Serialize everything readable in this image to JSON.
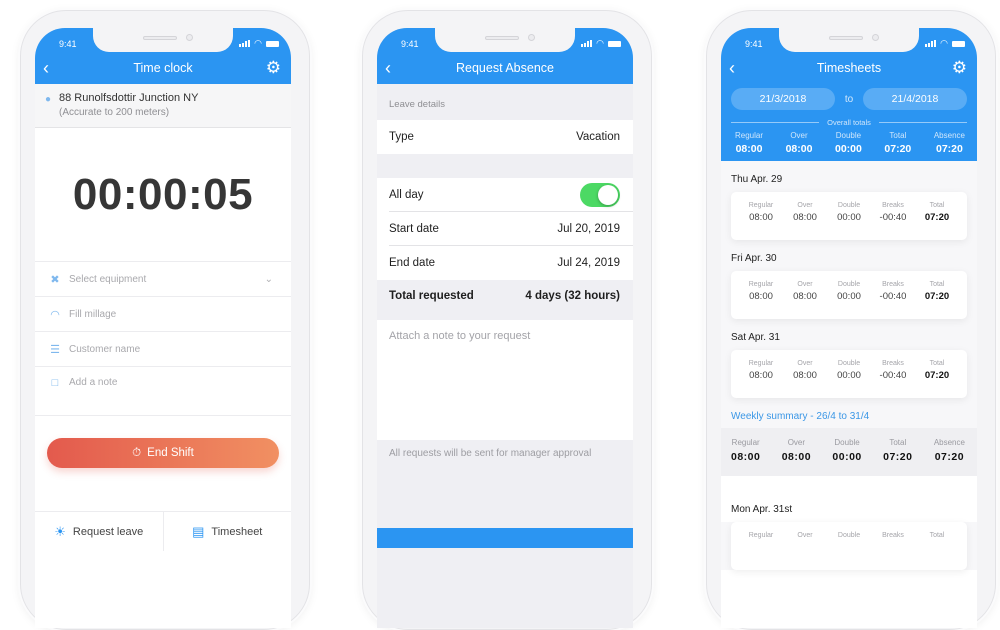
{
  "status_bar": {
    "time": "9:41"
  },
  "time_clock": {
    "title": "Time clock",
    "location": {
      "address": "88 Runolfsdottir Junction NY",
      "accuracy": "(Accurate to 200 meters)"
    },
    "timer": "00:00:05",
    "fields": [
      {
        "icon": "equipment-icon",
        "placeholder": "Select equipment",
        "has_dropdown": true
      },
      {
        "icon": "gauge-icon",
        "placeholder": "Fill millage"
      },
      {
        "icon": "list-icon",
        "placeholder": "Customer name"
      },
      {
        "icon": "note-icon",
        "placeholder": "Add a note"
      }
    ],
    "end_shift_label": "End Shift",
    "tabs": [
      {
        "icon": "sun-icon",
        "label": "Request leave"
      },
      {
        "icon": "calendar-icon",
        "label": "Timesheet"
      }
    ]
  },
  "request_absence": {
    "title": "Request Absence",
    "section_label": "Leave details",
    "type_label": "Type",
    "type_value": "Vacation",
    "all_day_label": "All day",
    "all_day_on": true,
    "start_label": "Start date",
    "start_value": "Jul 20, 2019",
    "end_label": "End date",
    "end_value": "Jul 24, 2019",
    "total_label": "Total requested",
    "total_value": "4 days (32 hours)",
    "note_placeholder": "Attach a note to your request",
    "approval_note": "All requests will be sent for manager approval"
  },
  "timesheets": {
    "title": "Timesheets",
    "from_date": "21/3/2018",
    "to_label": "to",
    "to_date": "21/4/2018",
    "overall_label": "Overall totals",
    "overall": [
      {
        "label": "Regular",
        "value": "08:00"
      },
      {
        "label": "Over",
        "value": "08:00"
      },
      {
        "label": "Double",
        "value": "00:00"
      },
      {
        "label": "Total",
        "value": "07:20"
      },
      {
        "label": "Absence",
        "value": "07:20"
      }
    ],
    "days": [
      {
        "title": "Thu Apr. 29",
        "cols": [
          {
            "label": "Regular",
            "value": "08:00"
          },
          {
            "label": "Over",
            "value": "08:00"
          },
          {
            "label": "Double",
            "value": "00:00"
          },
          {
            "label": "Breaks",
            "value": "-00:40"
          },
          {
            "label": "Total",
            "value": "07:20"
          }
        ]
      },
      {
        "title": "Fri Apr. 30",
        "cols": [
          {
            "label": "Regular",
            "value": "08:00"
          },
          {
            "label": "Over",
            "value": "08:00"
          },
          {
            "label": "Double",
            "value": "00:00"
          },
          {
            "label": "Breaks",
            "value": "-00:40"
          },
          {
            "label": "Total",
            "value": "07:20"
          }
        ]
      },
      {
        "title": "Sat Apr. 31",
        "cols": [
          {
            "label": "Regular",
            "value": "08:00"
          },
          {
            "label": "Over",
            "value": "08:00"
          },
          {
            "label": "Double",
            "value": "00:00"
          },
          {
            "label": "Breaks",
            "value": "-00:40"
          },
          {
            "label": "Total",
            "value": "07:20"
          }
        ]
      }
    ],
    "weekly_title": "Weekly summary - 26/4 to 31/4",
    "weekly": [
      {
        "label": "Regular",
        "value": "08:00"
      },
      {
        "label": "Over",
        "value": "08:00"
      },
      {
        "label": "Double",
        "value": "00:00"
      },
      {
        "label": "Total",
        "value": "07:20"
      },
      {
        "label": "Absence",
        "value": "07:20"
      }
    ],
    "next_day": {
      "title": "Mon Apr. 31st",
      "labels": [
        "Regular",
        "Over",
        "Double",
        "Breaks",
        "Total"
      ]
    }
  },
  "colors": {
    "primary": "#2b95f2",
    "end_shift_start": "#e35a4d",
    "end_shift_end": "#f19062",
    "toggle_on": "#4cd964"
  }
}
